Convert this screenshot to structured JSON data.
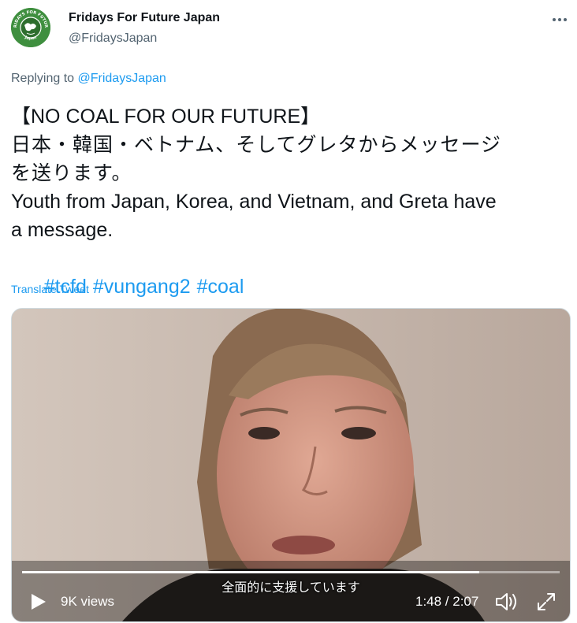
{
  "author": {
    "name": "Fridays For Future Japan",
    "handle": "@FridaysJapan",
    "avatar_text_top": "FRIDAYS FOR FUTURE",
    "avatar_text_bottom": "Japan",
    "avatar_color": "#3f8f3f"
  },
  "more_icon": "more-horizontal-icon",
  "reply": {
    "prefix": "Replying to ",
    "target": "@FridaysJapan"
  },
  "body": {
    "line1": "【NO COAL FOR OUR FUTURE】",
    "line2": "日本・韓国・ベトナム、そしてグレタからメッセージ",
    "line3": "を送ります。",
    "line4": "Youth from Japan, Korea, and Vietnam, and Greta have",
    "line5": "a message.",
    "hashtags": [
      "#tcfd",
      "#vungang2",
      "#coal"
    ]
  },
  "translate_label": "Translate Tweet",
  "video": {
    "subtitle": "全面的に支援しています",
    "views": "9K views",
    "time": "1:48 / 2:07",
    "progress": 0.85,
    "play_icon": "play-icon",
    "volume_icon": "volume-icon",
    "fullscreen_icon": "fullscreen-icon"
  },
  "colors": {
    "link": "#1d9bf0",
    "secondary_text": "#536471",
    "primary_text": "#0f1419"
  }
}
